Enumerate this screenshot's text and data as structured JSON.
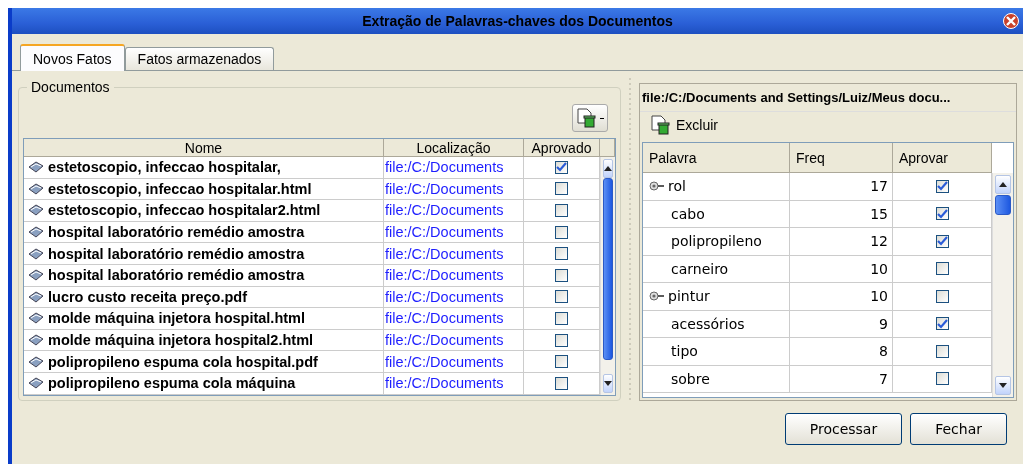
{
  "window": {
    "title": "Extração de Palavras-chaves dos Documentos"
  },
  "tabs": [
    {
      "label": "Novos Fatos",
      "selected": true
    },
    {
      "label": "Fatos armazenados",
      "selected": false
    }
  ],
  "documents": {
    "title": "Documentos",
    "columns": [
      "Nome",
      "Localização",
      "Aprovado"
    ],
    "rows": [
      {
        "name": "estetoscopio, infeccao hospitalar,",
        "location": "file:/C:/Documents",
        "checked": true
      },
      {
        "name": "estetoscopio, infeccao hospitalar.html",
        "location": "file:/C:/Documents",
        "checked": false
      },
      {
        "name": "estetoscopio, infeccao hospitalar2.html",
        "location": "file:/C:/Documents",
        "checked": false
      },
      {
        "name": "hospital laboratório remédio amostra",
        "location": "file:/C:/Documents",
        "checked": false
      },
      {
        "name": "hospital laboratório remédio amostra",
        "location": "file:/C:/Documents",
        "checked": false
      },
      {
        "name": "hospital laboratório remédio amostra",
        "location": "file:/C:/Documents",
        "checked": false
      },
      {
        "name": "lucro custo receita preço.pdf",
        "location": "file:/C:/Documents",
        "checked": false
      },
      {
        "name": "molde máquina injetora hospital.html",
        "location": "file:/C:/Documents",
        "checked": false
      },
      {
        "name": "molde máquina injetora hospital2.html",
        "location": "file:/C:/Documents",
        "checked": false
      },
      {
        "name": "polipropileno espuma cola hospital.pdf",
        "location": "file:/C:/Documents",
        "checked": false
      },
      {
        "name": "polipropileno espuma cola máquina",
        "location": "file:/C:/Documents",
        "checked": false
      }
    ]
  },
  "keywords": {
    "path": "file:/C:/Documents and Settings/Luiz/Meus docu...",
    "delete_label": "Excluir",
    "columns": [
      "Palavra",
      "Freq",
      "Aprovar"
    ],
    "rows": [
      {
        "word": "rol",
        "freq": "17",
        "checked": true,
        "expanded": true,
        "children": [
          {
            "word": "cabo",
            "freq": "15",
            "checked": true
          },
          {
            "word": "polipropileno",
            "freq": "12",
            "checked": true
          },
          {
            "word": "carneiro",
            "freq": "10",
            "checked": false
          }
        ]
      },
      {
        "word": "pintur",
        "freq": "10",
        "checked": false,
        "expanded": true,
        "children": [
          {
            "word": "acessórios",
            "freq": "9",
            "checked": true
          },
          {
            "word": "tipo",
            "freq": "8",
            "checked": false
          },
          {
            "word": "sobre",
            "freq": "7",
            "checked": false
          }
        ]
      }
    ]
  },
  "buttons": [
    "Processar",
    "Fechar"
  ]
}
